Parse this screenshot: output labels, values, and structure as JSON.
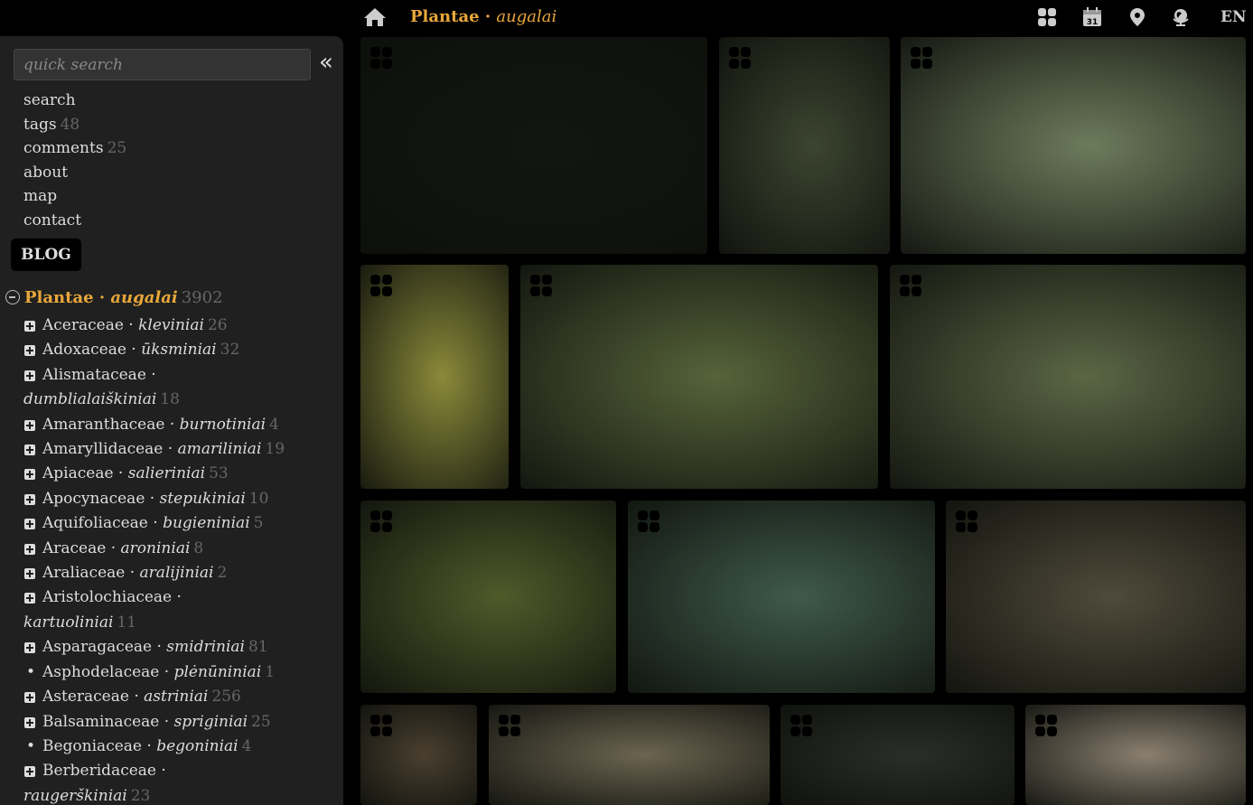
{
  "header": {
    "home_icon": "home-icon",
    "title": "Plantae",
    "separator": " · ",
    "title_lt": "augalai",
    "icons": [
      "grid-icon",
      "calendar-icon",
      "map-pin-icon",
      "globe-icon"
    ],
    "calendar_day": "31",
    "lang": "EN"
  },
  "sidebar": {
    "search_placeholder": "quick search",
    "collapse": "«",
    "nav": [
      {
        "label": "search",
        "count": ""
      },
      {
        "label": "tags",
        "count": "48"
      },
      {
        "label": "comments",
        "count": "25"
      },
      {
        "label": "about",
        "count": ""
      },
      {
        "label": "map",
        "count": ""
      },
      {
        "label": "contact",
        "count": ""
      }
    ],
    "blog": "BLOG",
    "root": {
      "name": "Plantae",
      "sep": " · ",
      "lt": "augalai",
      "count": "3902"
    },
    "tree": [
      {
        "name": "Aceraceae",
        "lt": "kleviniai",
        "count": "26",
        "kind": "plus"
      },
      {
        "name": "Adoxaceae",
        "lt": "ūksminiai",
        "count": "32",
        "kind": "plus"
      },
      {
        "name": "Alismataceae",
        "lt": "dumblialaiškiniai",
        "count": "18",
        "kind": "plus",
        "wrap": true
      },
      {
        "name": "Amaranthaceae",
        "lt": "burnotiniai",
        "count": "4",
        "kind": "plus"
      },
      {
        "name": "Amaryllidaceae",
        "lt": "amariliniai",
        "count": "19",
        "kind": "plus"
      },
      {
        "name": "Apiaceae",
        "lt": "salieriniai",
        "count": "53",
        "kind": "plus"
      },
      {
        "name": "Apocynaceae",
        "lt": "stepukiniai",
        "count": "10",
        "kind": "plus"
      },
      {
        "name": "Aquifoliaceae",
        "lt": "bugieniniai",
        "count": "5",
        "kind": "plus"
      },
      {
        "name": "Araceae",
        "lt": "aroniniai",
        "count": "8",
        "kind": "plus"
      },
      {
        "name": "Araliaceae",
        "lt": "aralijiniai",
        "count": "2",
        "kind": "plus"
      },
      {
        "name": "Aristolochiaceae",
        "lt": "kartuoliniai",
        "count": "11",
        "kind": "plus",
        "wrap": true
      },
      {
        "name": "Asparagaceae",
        "lt": "smidriniai",
        "count": "81",
        "kind": "plus"
      },
      {
        "name": "Asphodelaceae",
        "lt": "plėnūniniai",
        "count": "1",
        "kind": "bullet"
      },
      {
        "name": "Asteraceae",
        "lt": "astriniai",
        "count": "256",
        "kind": "plus"
      },
      {
        "name": "Balsaminaceae",
        "lt": "spriginiai",
        "count": "25",
        "kind": "plus"
      },
      {
        "name": "Begoniaceae",
        "lt": "begoniniai",
        "count": "4",
        "kind": "bullet"
      },
      {
        "name": "Berberidaceae",
        "lt": "raugerškiniai",
        "count": "23",
        "kind": "plus",
        "wrap": true
      }
    ]
  },
  "gallery": {
    "badge_icon": "stack-icon",
    "photos": [
      {
        "name": "maple-leaves",
        "bg": "#121611"
      },
      {
        "name": "adoxa-plant",
        "bg": "#3c4530"
      },
      {
        "name": "sagittaria-water-plants",
        "bg": "#6d7b5c"
      },
      {
        "name": "amaranthus-red-spikes",
        "bg": "#8a8a3a"
      },
      {
        "name": "allium-purple-flowers",
        "bg": "#56633a"
      },
      {
        "name": "dill-yellow-umbels",
        "bg": "#5b6645"
      },
      {
        "name": "vinca-periwinkle-flower",
        "bg": "#4f5a2a"
      },
      {
        "name": "holly-red-berries",
        "bg": "#3f5a4a"
      },
      {
        "name": "arum-red-fruit",
        "bg": "#4f4a3a"
      },
      {
        "name": "ivy-tree-trunk",
        "bg": "#4a4030"
      },
      {
        "name": "hairy-leaf-flower",
        "bg": "#6b6450"
      },
      {
        "name": "white-flowers",
        "bg": "#2a2e28"
      },
      {
        "name": "garden-view",
        "bg": "#8a8070"
      }
    ]
  }
}
